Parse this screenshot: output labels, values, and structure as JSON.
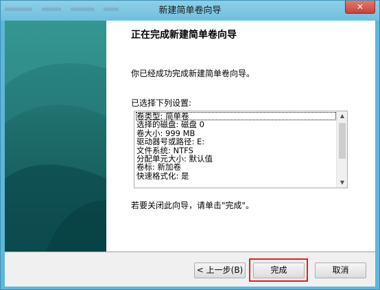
{
  "window": {
    "title": "新建简单卷向导",
    "close_label": "✕"
  },
  "wizard": {
    "heading": "正在完成新建简单卷向导",
    "intro": "你已经成功完成新建简单卷向导。",
    "list_label": "已选择下列设置:",
    "settings": [
      "卷类型: 简单卷",
      "选择的磁盘: 磁盘 0",
      "卷大小: 999 MB",
      "驱动器号或路径: E:",
      "文件系统: NTFS",
      "分配单元大小: 默认值",
      "卷标: 新加卷",
      "快速格式化: 是"
    ],
    "closing": "若要关闭此向导，请单击\"完成\"。"
  },
  "buttons": {
    "back": "< 上一步(B)",
    "finish": "完成",
    "cancel": "取消"
  },
  "icons": {
    "scroll_up": "▲",
    "scroll_down": "▼"
  },
  "colors": {
    "frame": "#5fb6d8",
    "side_panel": "#1f6e6c",
    "highlight": "#e02020"
  }
}
